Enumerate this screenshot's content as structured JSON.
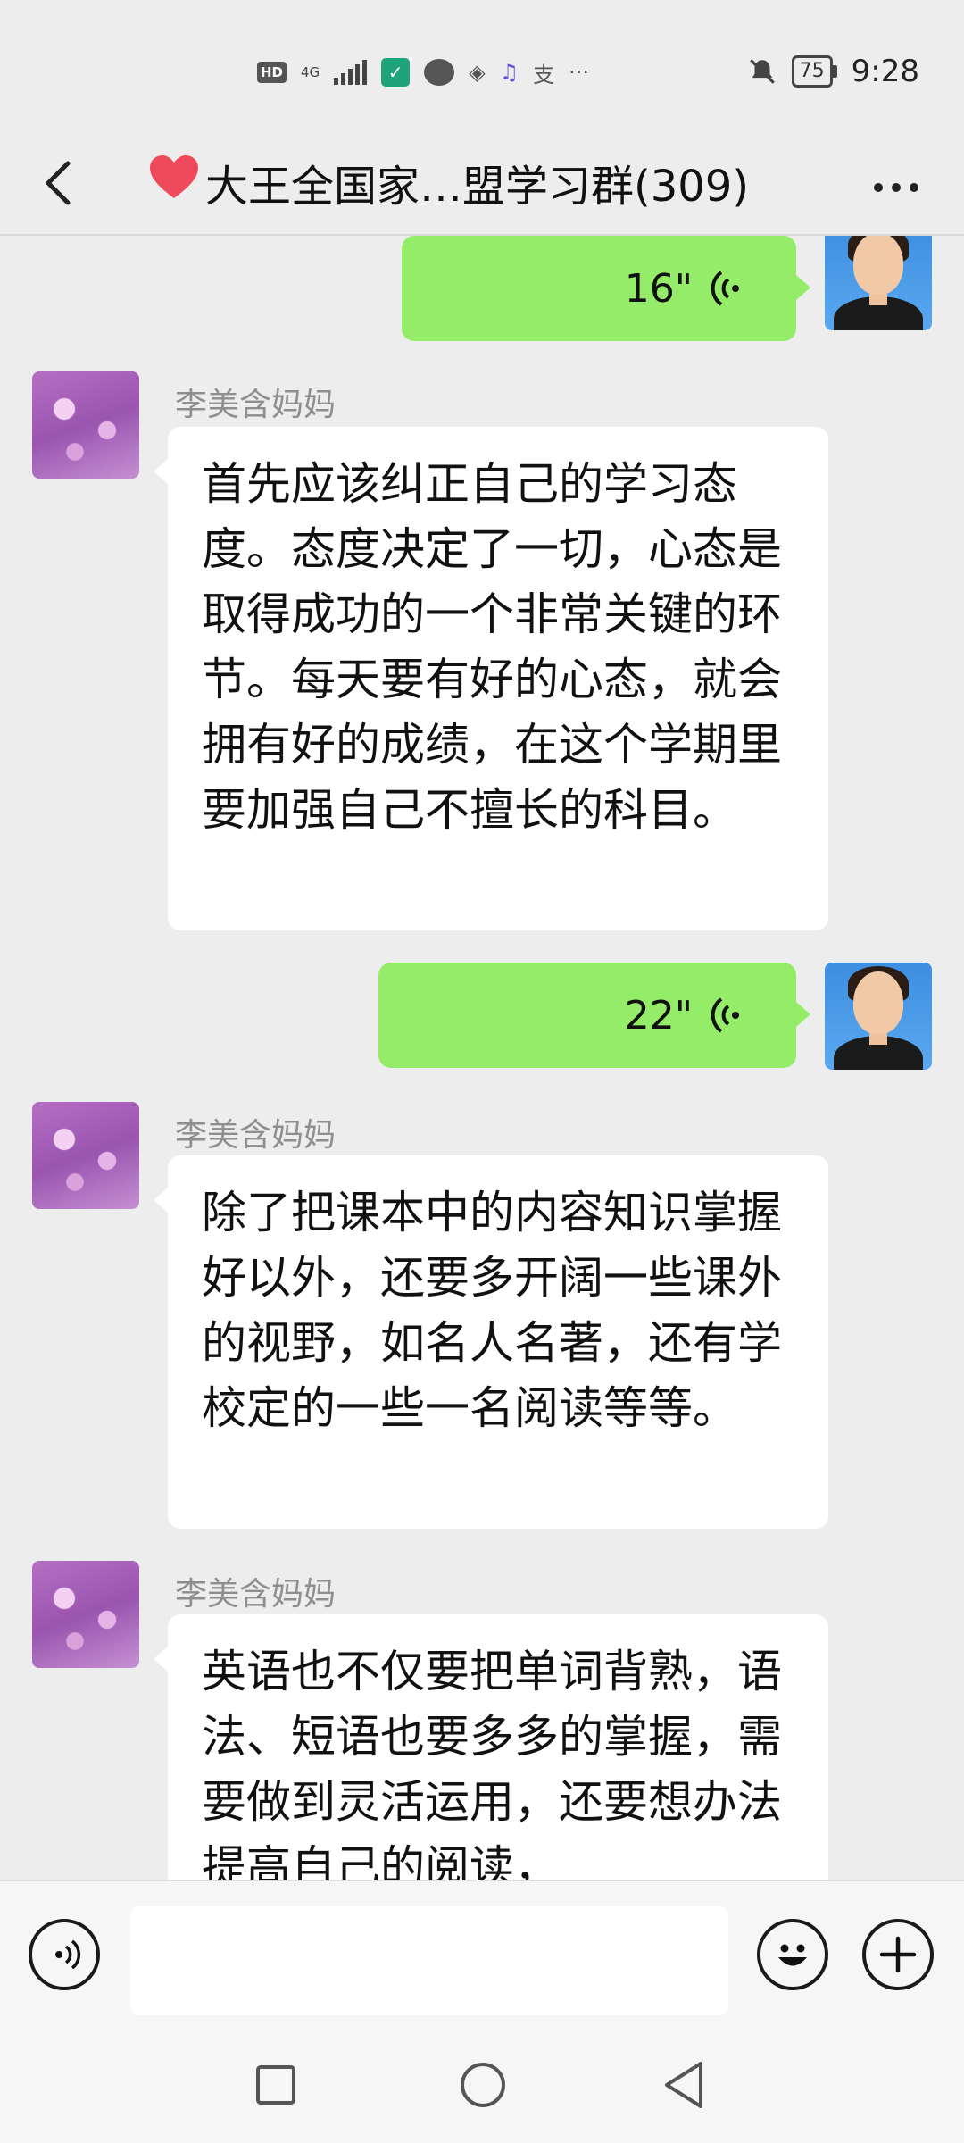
{
  "status_bar": {
    "hd": "HD",
    "network": "4G",
    "battery": "75",
    "time": "9:28"
  },
  "header": {
    "heart": "❤️",
    "title": "大王全国家…盟学习群(309)"
  },
  "messages": [
    {
      "type": "voice",
      "from": "me",
      "duration": "16\""
    },
    {
      "type": "text",
      "from": "other",
      "sender": "李美含妈妈",
      "text": "首先应该纠正自己的学习态度。态度决定了一切，心态是取得成功的一个非常关键的环节。每天要有好的心态，就会拥有好的成绩，在这个学期里要加强自己不擅长的科目。"
    },
    {
      "type": "voice",
      "from": "me",
      "duration": "22\""
    },
    {
      "type": "text",
      "from": "other",
      "sender": "李美含妈妈",
      "text": "除了把课本中的内容知识掌握好以外，还要多开阔一些课外的视野，如名人名著，还有学校定的一些一名阅读等等。"
    },
    {
      "type": "text",
      "from": "other",
      "sender": "李美含妈妈",
      "text": "英语也不仅要把单词背熟，语法、短语也要多多的掌握，需要做到灵活运用，还要想办法提高自己的阅读，"
    }
  ],
  "input": {
    "value": "",
    "placeholder": ""
  },
  "icons": {
    "back": "chevron-left-icon",
    "more": "more-icon",
    "voice_toggle": "voice-icon",
    "emoji": "emoji-icon",
    "add": "plus-icon"
  }
}
